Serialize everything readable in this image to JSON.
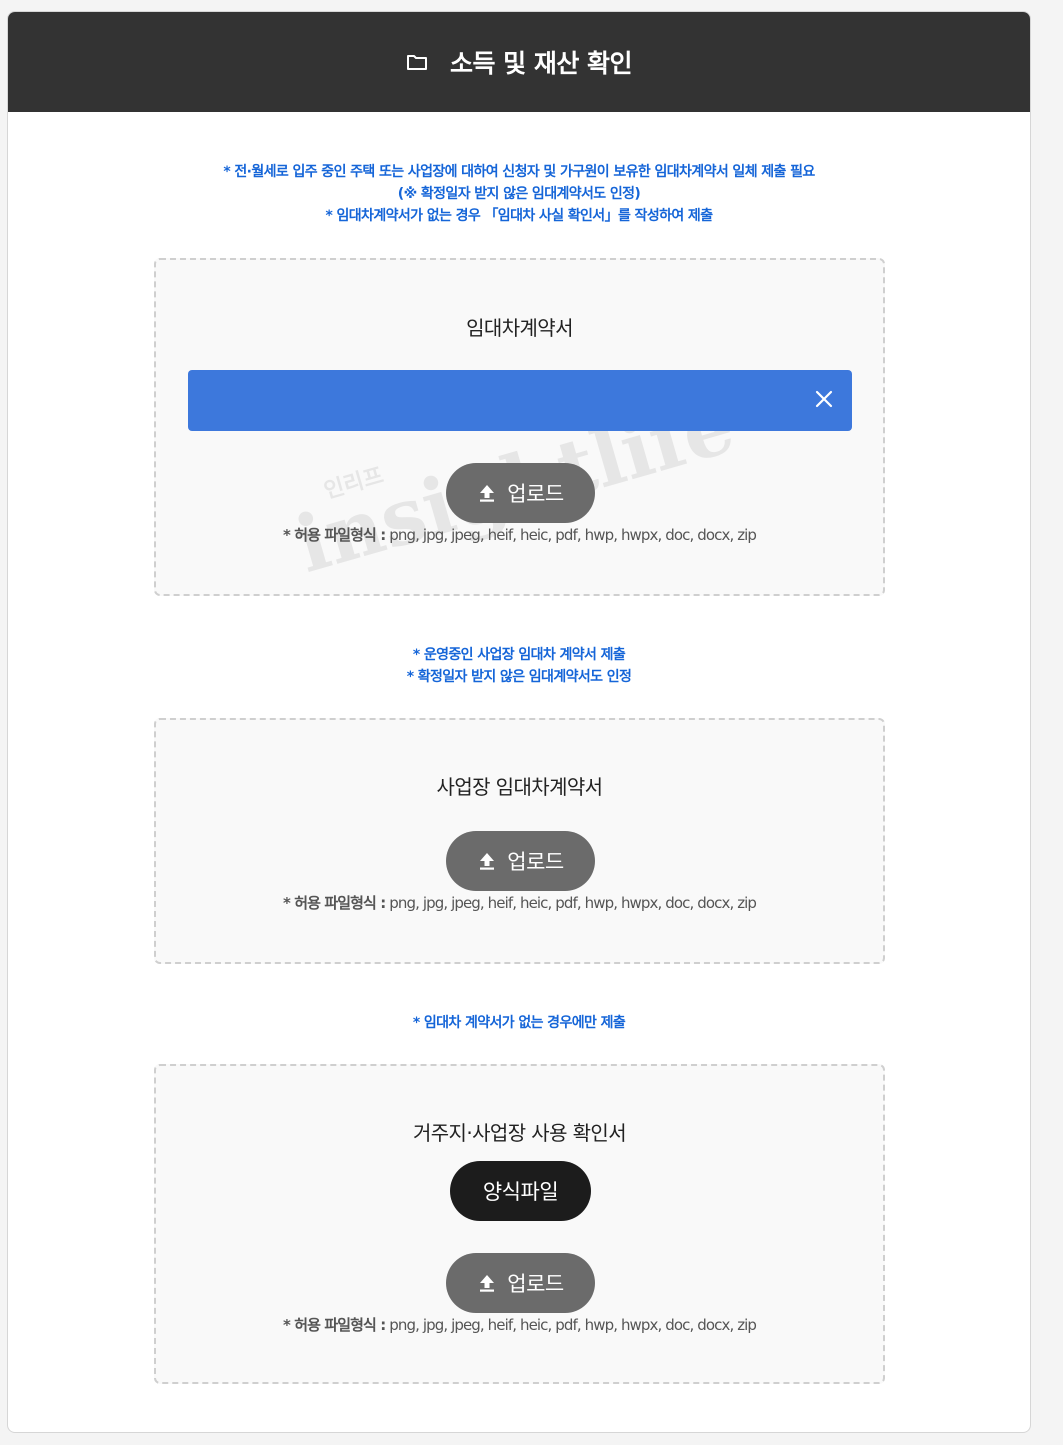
{
  "panel": {
    "title": "소득 및 재산 확인",
    "icon": "folder-icon"
  },
  "sections": [
    {
      "notice": [
        "* 전·월세로 입주 중인 주택 또는 사업장에 대하여 신청자 및 가구원이 보유한 임대차계약서 일체 제출 필요",
        "(※ 확정일자 받지 않은 임대계약서도 인정)",
        "* 임대차계약서가 없는 경우 「임대차 사실 확인서」를 작성하여 제출"
      ],
      "title": "임대차계약서",
      "upload_label": "업로드",
      "hint_prefix": "* 허용 파일형식 :",
      "hint_formats": "png, jpg, jpeg, heif, heic, pdf, hwp, hwpx, doc, docx, zip"
    },
    {
      "notice": [
        "* 운영중인 사업장 임대차 계약서 제출",
        "* 확정일자 받지 않은 임대계약서도 인정"
      ],
      "title": "사업장 임대차계약서",
      "upload_label": "업로드",
      "hint_prefix": "* 허용 파일형식 :",
      "hint_formats": "png, jpg, jpeg, heif, heic, pdf, hwp, hwpx, doc, docx, zip"
    },
    {
      "notice": [
        "* 임대차 계약서가 없는 경우에만 제출"
      ],
      "title": "거주지·사업장 사용 확인서",
      "form_label": "양식파일",
      "upload_label": "업로드",
      "hint_prefix": "* 허용 파일형식 :",
      "hint_formats": "png, jpg, jpeg, heif, heic, pdf, hwp, hwpx, doc, docx, zip"
    }
  ],
  "watermark": {
    "text": "insightlife",
    "small_text": "인리프"
  },
  "colors": {
    "header_bg": "#333333",
    "notice": "#1565d8",
    "file_bar": "#3d78dc",
    "upload_button": "#6b6b6b",
    "form_button": "#1c1c1c"
  }
}
